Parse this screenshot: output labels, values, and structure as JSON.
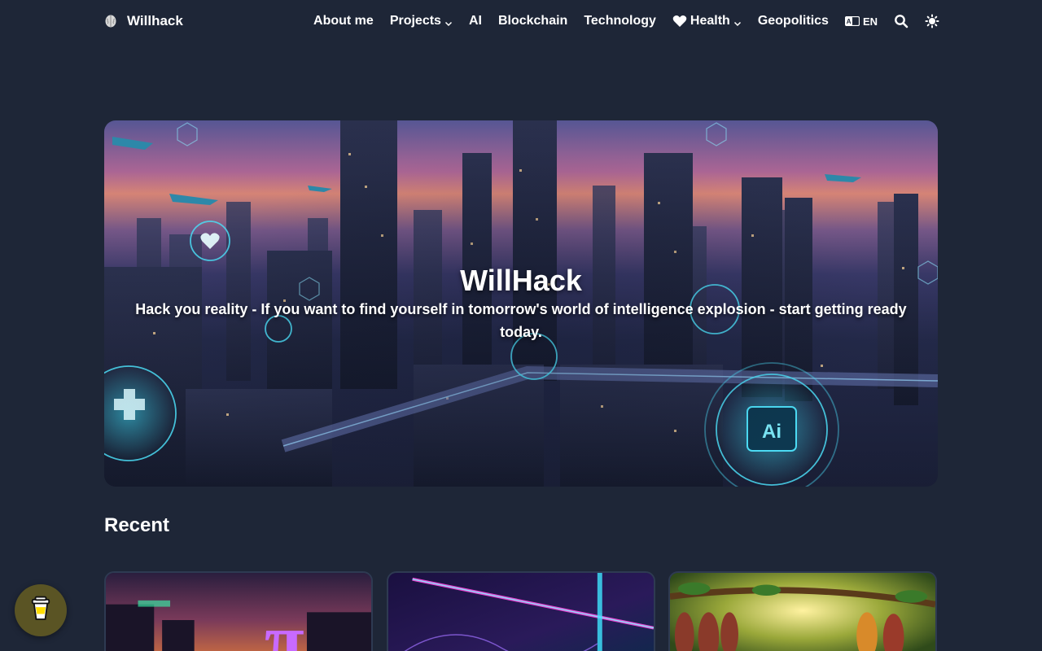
{
  "header": {
    "brand": "Willhack",
    "nav": {
      "about": "About me",
      "projects": "Projects",
      "ai": "AI",
      "blockchain": "Blockchain",
      "technology": "Technology",
      "health": "Health",
      "geopolitics": "Geopolitics",
      "language": "EN"
    }
  },
  "hero": {
    "title": "WillHack",
    "subtitle": "Hack you reality - If you want to find yourself in tomorrow's world of intelligence explosion - start getting ready today."
  },
  "recent": {
    "heading": "Recent"
  },
  "colors": {
    "background": "#1e2637",
    "text": "#ffffff",
    "coffee_button": "#5a5424"
  },
  "icons": [
    "brain-icon",
    "chevron-down-icon",
    "heart-icon",
    "language-icon",
    "search-icon",
    "theme-toggle-icon",
    "coffee-cup-icon"
  ]
}
